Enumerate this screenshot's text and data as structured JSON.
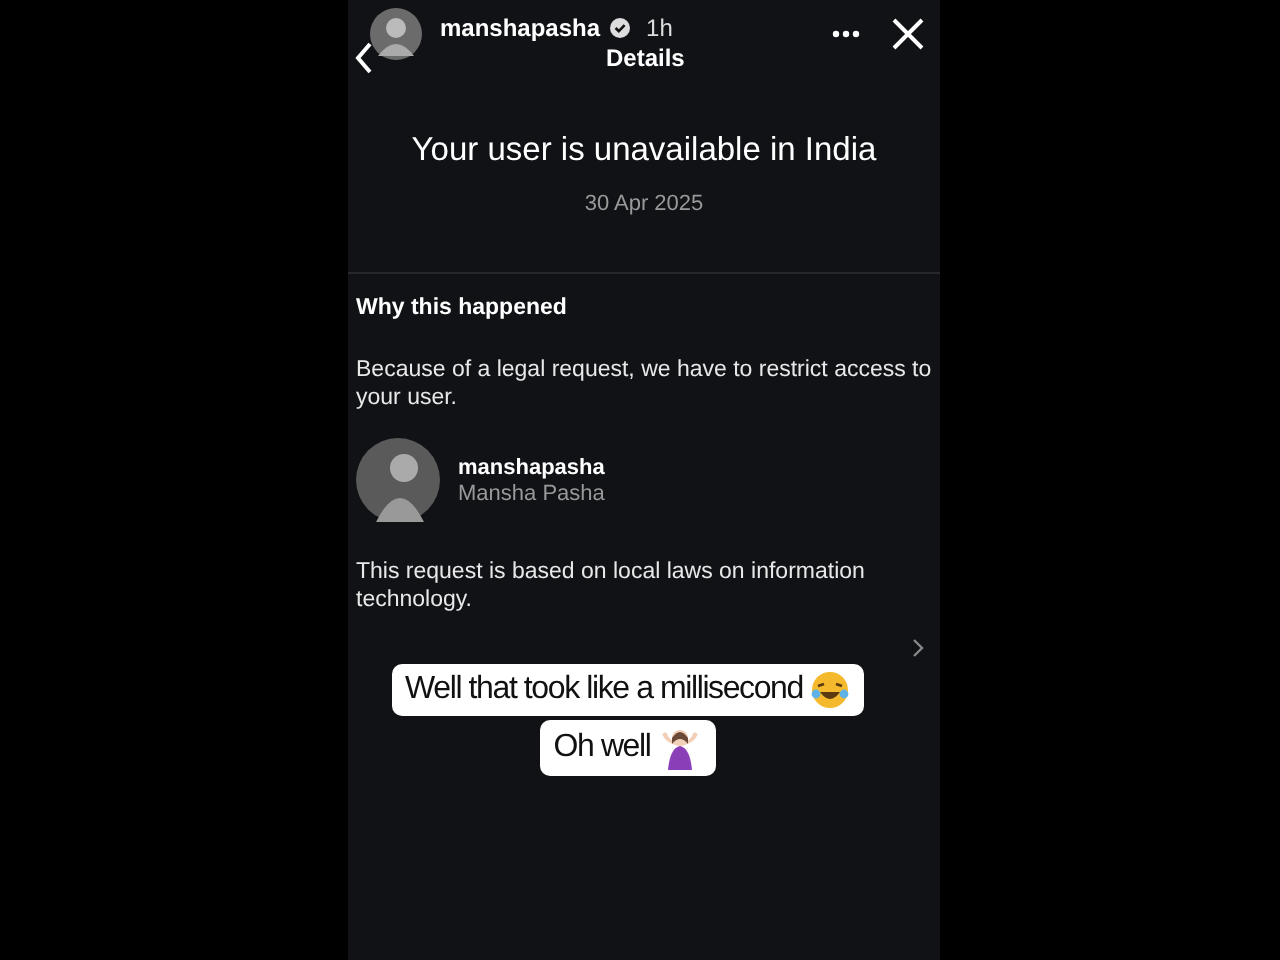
{
  "story_header": {
    "username": "manshapasha",
    "verified": true,
    "time": "1h",
    "title": "Details"
  },
  "notice": {
    "title": "Your user is unavailable in India",
    "date": "30 Apr 2025"
  },
  "reason": {
    "heading": "Why this happened",
    "explanation": "Because of a legal request, we have to restrict access to your user.",
    "account": {
      "username": "manshapasha",
      "name": "Mansha Pasha"
    },
    "basis": "This request is based on local laws on information technology."
  },
  "stickers": [
    {
      "text": "Well that took like a millisecond",
      "kind": "laughing"
    },
    {
      "text": "Oh well",
      "kind": "shrug"
    }
  ]
}
